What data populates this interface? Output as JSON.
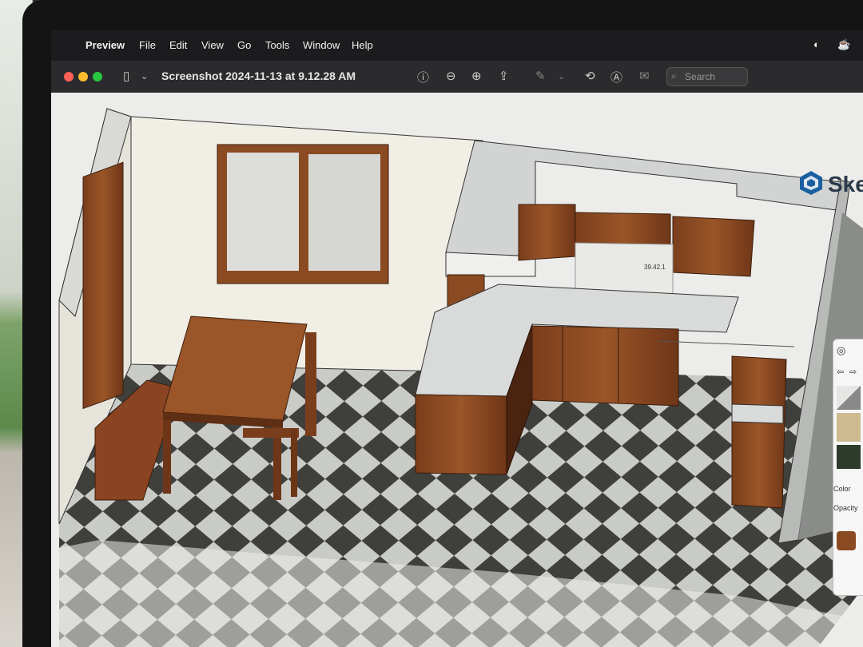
{
  "menubar": {
    "app_name": "Preview",
    "items": [
      "File",
      "Edit",
      "View",
      "Go",
      "Tools",
      "Window",
      "Help"
    ]
  },
  "window": {
    "title": "Screenshot 2024-11-13 at 9.12.28 AM",
    "toolbar_icons": [
      "sidebar-toggle-icon",
      "chevron-down-icon",
      "info-icon",
      "zoom-out-icon",
      "zoom-in-icon",
      "share-icon",
      "markup-pen-icon",
      "rotate-icon",
      "annotate-icon",
      "form-fill-icon"
    ],
    "search_placeholder": "Search"
  },
  "app_logo_text": "Ske",
  "dimension_label": "39.42.1",
  "side_panel": {
    "color_label": "Color",
    "opacity_label": "Opacity"
  },
  "colors": {
    "wood": "#8a4a22",
    "wood_dark": "#5e2f14",
    "countertop": "#d8dbda",
    "wall": "#f1eee6",
    "tile_light": "#c9cbc7",
    "tile_dark": "#3f3f3c",
    "sketchup_blue": "#1b5fa0"
  }
}
